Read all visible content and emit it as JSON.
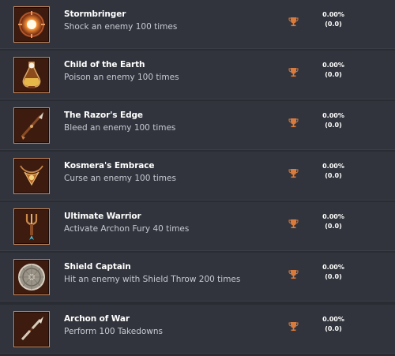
{
  "achievements": [
    {
      "title": "Stormbringer",
      "description": "Shock an enemy 100 times",
      "percent": "0.00%",
      "count": "(0.0)",
      "icon": "lightning-orb-icon"
    },
    {
      "title": "Child of the Earth",
      "description": "Poison an enemy 100 times",
      "percent": "0.00%",
      "count": "(0.0)",
      "icon": "poison-flask-icon"
    },
    {
      "title": "The Razor's Edge",
      "description": "Bleed an enemy 100 times",
      "percent": "0.00%",
      "count": "(0.0)",
      "icon": "spear-icon"
    },
    {
      "title": "Kosmera's Embrace",
      "description": "Curse an enemy 100 times",
      "percent": "0.00%",
      "count": "(0.0)",
      "icon": "amulet-icon"
    },
    {
      "title": "Ultimate Warrior",
      "description": "Activate Archon Fury 40 times",
      "percent": "0.00%",
      "count": "(0.0)",
      "icon": "trident-icon"
    },
    {
      "title": "Shield Captain",
      "description": "Hit an enemy with Shield Throw 200 times",
      "percent": "0.00%",
      "count": "(0.0)",
      "icon": "round-shield-icon"
    },
    {
      "title": "Archon of War",
      "description": "Perform 100 Takedowns",
      "percent": "0.00%",
      "count": "(0.0)",
      "icon": "broken-spear-icon"
    }
  ],
  "colors": {
    "background": "#2a2c33",
    "row": "#31343c",
    "title": "#ffffff",
    "description": "#c7cad2",
    "trophy": "#d97b3c",
    "icon_border": "#c9885c",
    "icon_bg": "#3d1b0f"
  }
}
